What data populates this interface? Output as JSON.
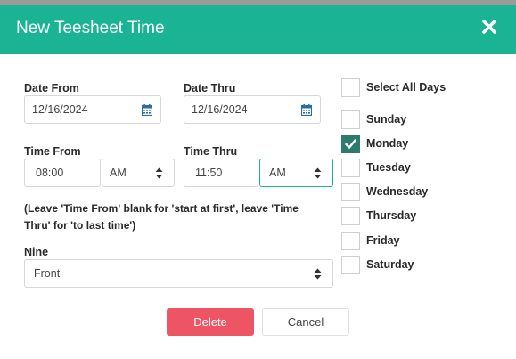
{
  "modal": {
    "title": "New Teesheet Time"
  },
  "form": {
    "date_from": {
      "label": "Date From",
      "value": "12/16/2024"
    },
    "date_thru": {
      "label": "Date Thru",
      "value": "12/16/2024"
    },
    "time_from": {
      "label": "Time From",
      "value": "08:00",
      "ampm": "AM"
    },
    "time_thru": {
      "label": "Time Thru",
      "value": "11:50",
      "ampm": "AM"
    },
    "hint": "(Leave 'Time From' blank for 'start at first', leave 'Time Thru' for 'to last time')",
    "nine": {
      "label": "Nine",
      "value": "Front"
    }
  },
  "days": {
    "select_all_label": "Select All Days",
    "select_all_checked": false,
    "items": [
      {
        "label": "Sunday",
        "checked": false
      },
      {
        "label": "Monday",
        "checked": true
      },
      {
        "label": "Tuesday",
        "checked": false
      },
      {
        "label": "Wednesday",
        "checked": false
      },
      {
        "label": "Thursday",
        "checked": false
      },
      {
        "label": "Friday",
        "checked": false
      },
      {
        "label": "Saturday",
        "checked": false
      }
    ]
  },
  "buttons": {
    "delete_label": "Delete",
    "cancel_label": "Cancel"
  },
  "colors": {
    "header": "#1ab394",
    "delete": "#ed5565",
    "checked": "#2c7b6c"
  },
  "icons": {
    "close": "close-icon",
    "calendar": "calendar-icon",
    "select_arrows": "sort-arrows-icon",
    "check": "check-icon"
  }
}
